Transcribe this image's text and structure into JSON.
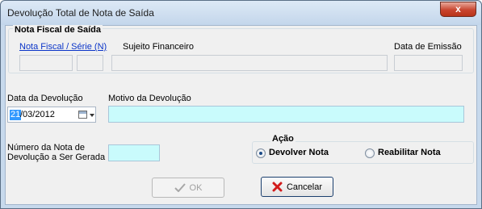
{
  "window": {
    "title": "Devolução Total de Nota de Saída",
    "close_glyph": "x"
  },
  "nota_fiscal": {
    "group_title": "Nota Fiscal de Saída",
    "nf_serie_label": "Nota Fiscal / Série (N)",
    "sujeito_label": "Sujeito Financeiro",
    "data_emissao_label": "Data de Emissão",
    "nota_value": "",
    "serie_value": "",
    "sujeito_value": "",
    "data_emissao_value": ""
  },
  "devolucao": {
    "data_label": "Data da Devolução",
    "data_day_selected": "21",
    "data_rest": "/03/2012",
    "motivo_label": "Motivo da Devolução",
    "motivo_value": "",
    "numero_label_line1": "Número da Nota de",
    "numero_label_line2": "Devolução a Ser Gerada",
    "numero_value": ""
  },
  "acao": {
    "group_title": "Ação",
    "options": [
      {
        "label": "Devolver Nota",
        "selected": true
      },
      {
        "label": "Reabilitar Nota",
        "selected": false
      }
    ]
  },
  "buttons": {
    "ok_label": "OK",
    "ok_enabled": false,
    "cancel_label": "Cancelar"
  },
  "icons": {
    "ok": "check-icon",
    "cancel": "red-x-icon",
    "calendar": "calendar-icon"
  }
}
